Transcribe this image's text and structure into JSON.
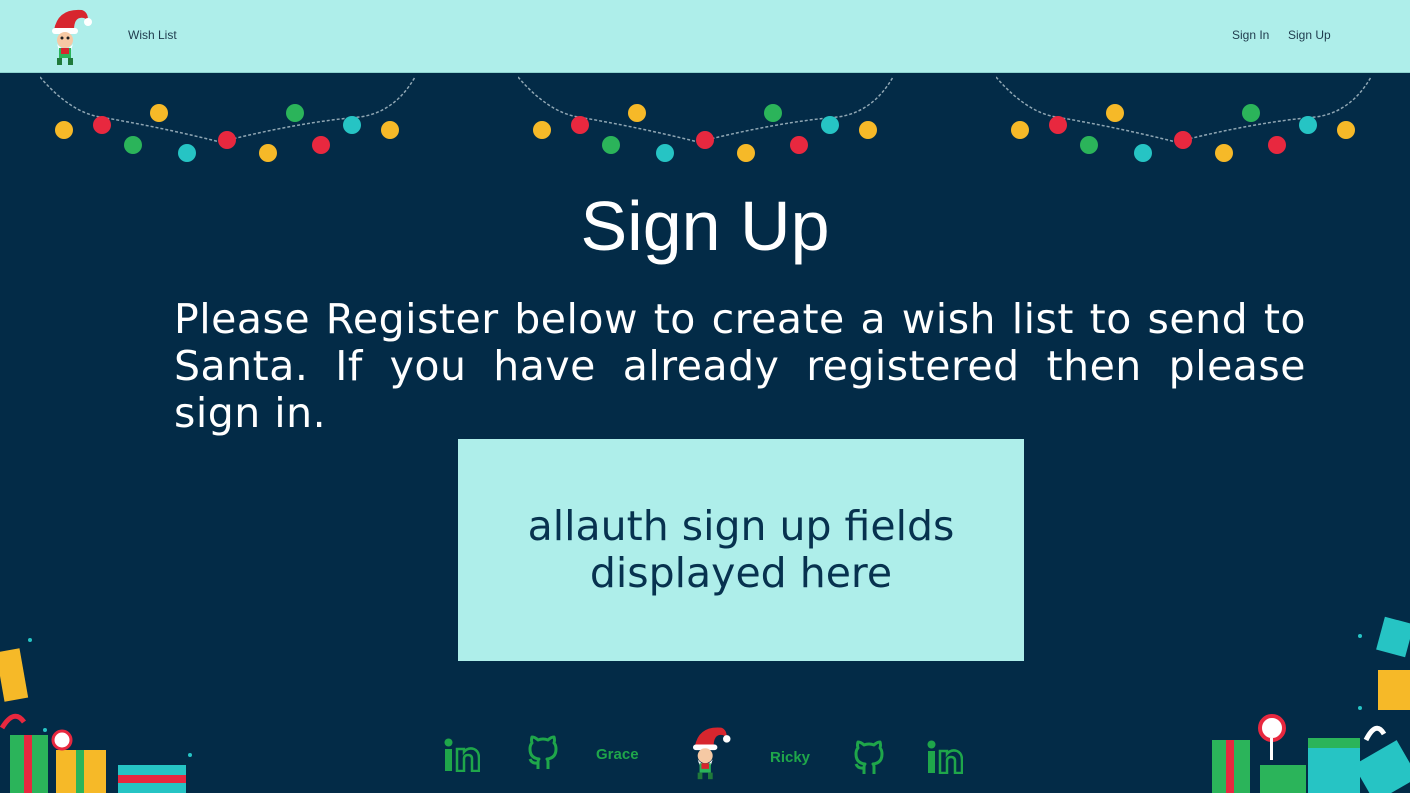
{
  "nav": {
    "logo_icon": "elf-gnome-logo-icon",
    "wish_list": "Wish List",
    "sign_in": "Sign In",
    "sign_up": "Sign Up"
  },
  "main": {
    "title": "Sign Up",
    "intro": "Please Register below to create a wish list to send to Santa. If you have already registered then please sign in.",
    "form_placeholder": "allauth sign up fields displayed here"
  },
  "footer": {
    "left_linkedin_icon": "linkedin-icon",
    "left_github_icon": "github-icon",
    "left_name": "Grace",
    "center_icon": "elf-gnome-icon",
    "right_name": "Ricky",
    "right_github_icon": "github-icon",
    "right_linkedin_icon": "linkedin-icon"
  },
  "colors": {
    "navbar_bg": "#aeeeea",
    "page_bg": "#032b47",
    "form_bg": "#aeeeea",
    "footer_icon": "#1fa64a",
    "bulb_yellow": "#f6b928",
    "bulb_red": "#e8283f",
    "bulb_green": "#2bb45a",
    "bulb_teal": "#26c4c4"
  }
}
